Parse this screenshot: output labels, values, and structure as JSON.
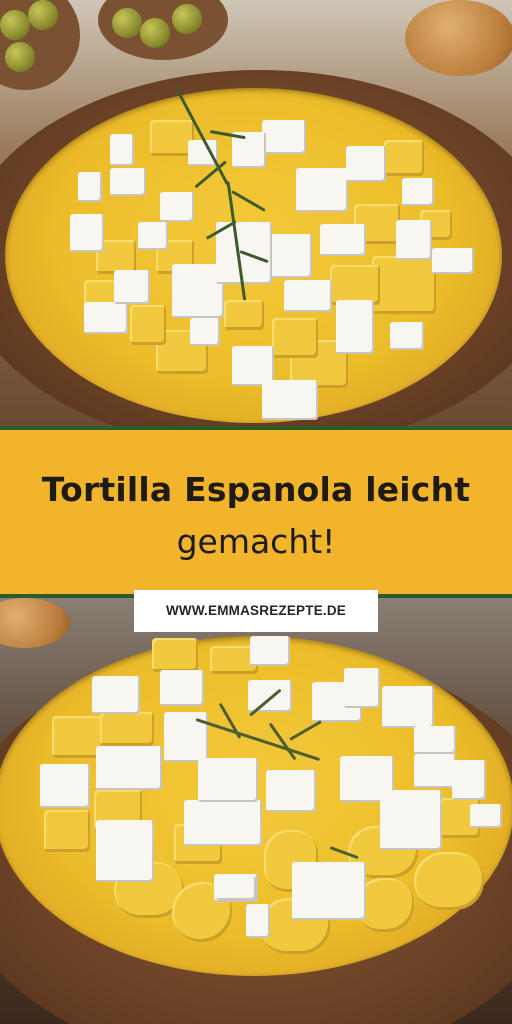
{
  "title": {
    "line1": "Tortilla Espanola leicht",
    "line2": "gemacht!"
  },
  "website": "WWW.EMMASREZEPTE.DE",
  "colors": {
    "banner": "#f2b42a",
    "divider": "#2f5a2a",
    "text": "#1e1a14",
    "badge": "#ffffff"
  },
  "images": {
    "top": "tortilla-with-feta-and-rosemary-photo",
    "bottom": "tortilla-with-feta-and-thyme-photo"
  }
}
